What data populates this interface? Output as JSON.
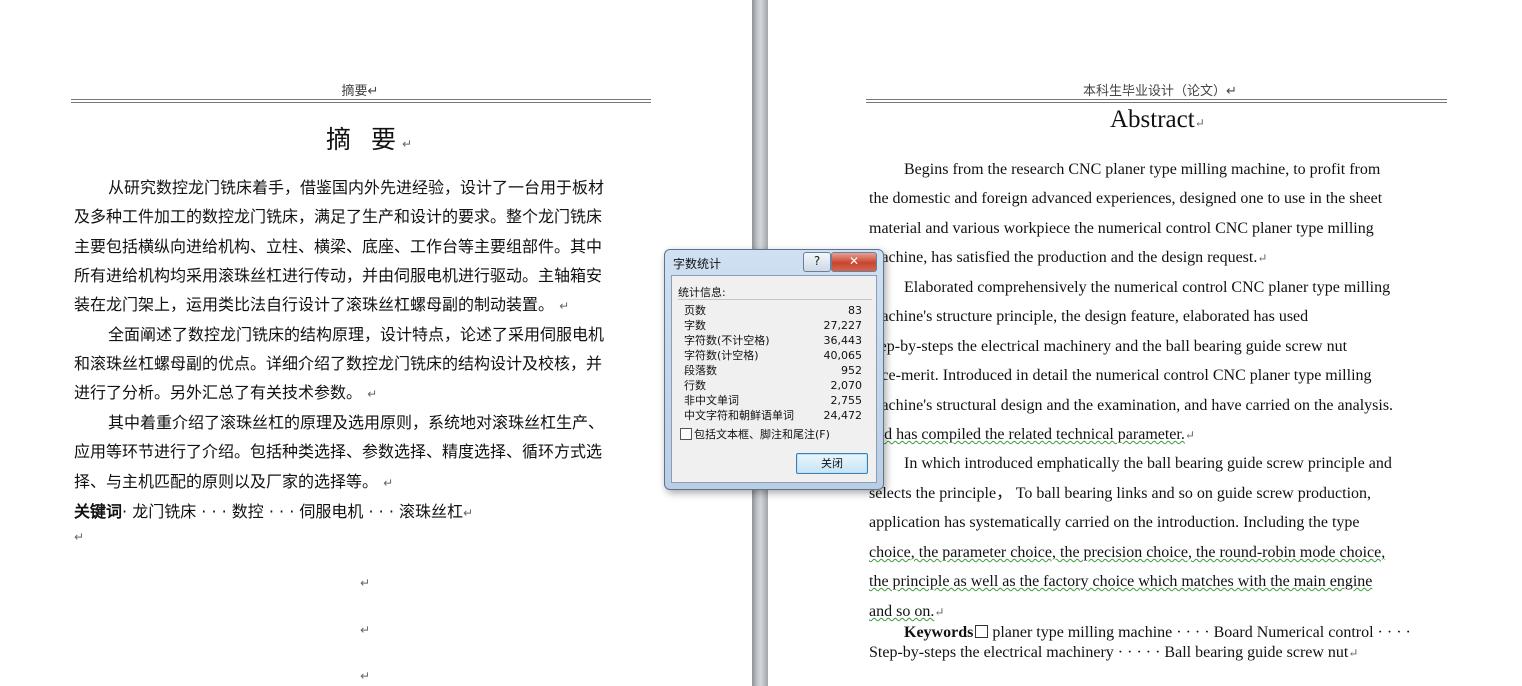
{
  "left_page": {
    "header": "摘要↵",
    "title": "摘 要",
    "paragraph_mark": "↵",
    "lines": [
      "从研究数控龙门铣床着手，借鉴国内外先进经验，设计了一台用于板材",
      "及多种工件加工的数控龙门铣床，满足了生产和设计的要求。整个龙门铣床",
      "主要包括横纵向进给机构、立柱、横梁、底座、工作台等主要组部件。其中",
      "所有进给机构均采用滚珠丝杠进行传动，并由伺服电机进行驱动。主轴箱安",
      "装在龙门架上，运用类比法自行设计了滚珠丝杠螺母副的制动装置。",
      "全面阐述了数控龙门铣床的结构原理，设计特点，论述了采用伺服电机",
      "和滚珠丝杠螺母副的优点。详细介绍了数控龙门铣床的结构设计及校核，并",
      "进行了分析。另外汇总了有关技术参数。",
      "其中着重介绍了滚珠丝杠的原理及选用原则，系统地对滚珠丝杠生产、",
      "应用等环节进行了介绍。包括种类选择、参数选择、精度选择、循环方式选",
      "择、与主机匹配的原则以及厂家的选择等。"
    ],
    "keywords_label": "关键词",
    "keywords": "· 龙门铣床 · · · 数控 · · · 伺服电机 · · · 滚珠丝杠"
  },
  "right_page": {
    "header": "本科生毕业设计（论文）↵",
    "title": "Abstract",
    "lines": [
      "Begins from the research CNC planer type milling machine, to profit from",
      "the domestic and foreign advanced experiences, designed one to use in the sheet",
      "material and various workpiece the numerical control CNC planer type milling",
      "machine, has satisfied the production and the design request.",
      "Elaborated comprehensively the numerical control CNC planer type milling",
      "machine's structure principle, the design feature, elaborated has used",
      "step-by-steps the electrical machinery and the ball bearing guide screw nut",
      "vice-merit. Introduced in detail the numerical control CNC planer type milling",
      "machine's structural design and the examination, and have carried on the analysis.",
      "and has compiled the related technical parameter.",
      "In which introduced emphatically the ball bearing guide screw principle and",
      "selects the principle， To ball bearing links and so on guide screw production,",
      "application has systematically carried on the introduction. Including the type",
      "choice, the parameter choice, the precision choice, the round-robin mode choice,",
      "the principle as well as the factory choice which matches with the main engine",
      "and so on."
    ],
    "keywords_label": "Keywords",
    "keywords_line1": "planer type milling machine · · · · Board Numerical control · · · ·",
    "keywords_line2": "Step-by-steps the electrical machinery · · · · · Ball bearing guide screw nut"
  },
  "dialog": {
    "title": "字数统计",
    "help": "?",
    "close_x": "✕",
    "stats_heading": "统计信息:",
    "stats": [
      {
        "label": "页数",
        "value": "83"
      },
      {
        "label": "字数",
        "value": "27,227"
      },
      {
        "label": "字符数(不计空格)",
        "value": "36,443"
      },
      {
        "label": "字符数(计空格)",
        "value": "40,065"
      },
      {
        "label": "段落数",
        "value": "952"
      },
      {
        "label": "行数",
        "value": "2,070"
      },
      {
        "label": "非中文单词",
        "value": "2,755"
      },
      {
        "label": "中文字符和朝鲜语单词",
        "value": "24,472"
      }
    ],
    "include_label": "包括文本框、脚注和尾注(F)",
    "include_checked": false,
    "close_button": "关闭"
  }
}
